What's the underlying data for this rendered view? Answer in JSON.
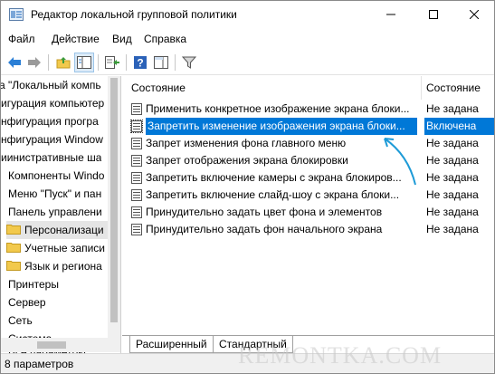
{
  "window": {
    "title": "Редактор локальной групповой политики",
    "controls": {
      "minimize": "—",
      "maximize": "☐",
      "close": "✕"
    }
  },
  "menu": [
    "Файл",
    "Действие",
    "Вид",
    "Справка"
  ],
  "toolbar": {
    "icons": [
      "back-arrow-icon",
      "forward-arrow-icon",
      "up-folder-icon",
      "show-hide-tree-icon",
      "export-list-icon",
      "help-icon",
      "show-pane-icon",
      "filter-icon"
    ]
  },
  "tree": {
    "items": [
      {
        "label": "Политика \"Локальный компьютер\"",
        "shown": "а \"Локальный компь"
      },
      {
        "label": "Конфигурация компьютера",
        "shown": "игурация компьютер"
      },
      {
        "label": "Конфигурация пользователя",
        "shown": "нфигурация програ"
      },
      {
        "label": "Конфигурация Windows",
        "shown": "нфигурация Window"
      },
      {
        "label": "Административные шаблоны",
        "shown": "иинистративные ша"
      },
      {
        "label": "Компоненты Windows",
        "shown": "Компоненты Windo"
      },
      {
        "label": "Меню \"Пуск\" и панель задач",
        "shown": "Меню \"Пуск\" и пан"
      },
      {
        "label": "Панель управления",
        "shown": "Панель управлени"
      },
      {
        "label": "Персонализация",
        "shown": "Персонализаци",
        "selected": true
      },
      {
        "label": "Учетные записи",
        "shown": "Учетные записи"
      },
      {
        "label": "Язык и региональные",
        "shown": "Язык и региона"
      },
      {
        "label": "Принтеры",
        "shown": "Принтеры"
      },
      {
        "label": "Сервер",
        "shown": "Сервер"
      },
      {
        "label": "Сеть",
        "shown": "Сеть"
      },
      {
        "label": "Система",
        "shown": "Система"
      },
      {
        "label": "Все параметры",
        "shown": "Все параметры"
      }
    ]
  },
  "list": {
    "columns": {
      "name": "Состояние",
      "state": "Состояние"
    },
    "rows": [
      {
        "name": "Применить конкретное изображение экрана блоки...",
        "state": "Не задана"
      },
      {
        "name": "Запретить изменение изображения экрана блоки...",
        "state": "Включена",
        "selected": true
      },
      {
        "name": "Запрет изменения фона главного меню",
        "state": "Не задана"
      },
      {
        "name": "Запрет отображения экрана блокировки",
        "state": "Не задана"
      },
      {
        "name": "Запретить включение камеры с экрана блокиров...",
        "state": "Не задана"
      },
      {
        "name": "Запретить включение слайд-шоу с экрана блоки...",
        "state": "Не задана"
      },
      {
        "name": "Принудительно задать цвет фона и элементов",
        "state": "Не задана"
      },
      {
        "name": "Принудительно задать фон начального экрана",
        "state": "Не задана"
      }
    ]
  },
  "tabs": [
    "Расширенный",
    "Стандартный"
  ],
  "status": "8 параметров",
  "watermark": "REMONTKA.COM",
  "colors": {
    "selection": "#0078d7",
    "arrow": "#1e9bd7",
    "folder": "#f2c94c"
  }
}
